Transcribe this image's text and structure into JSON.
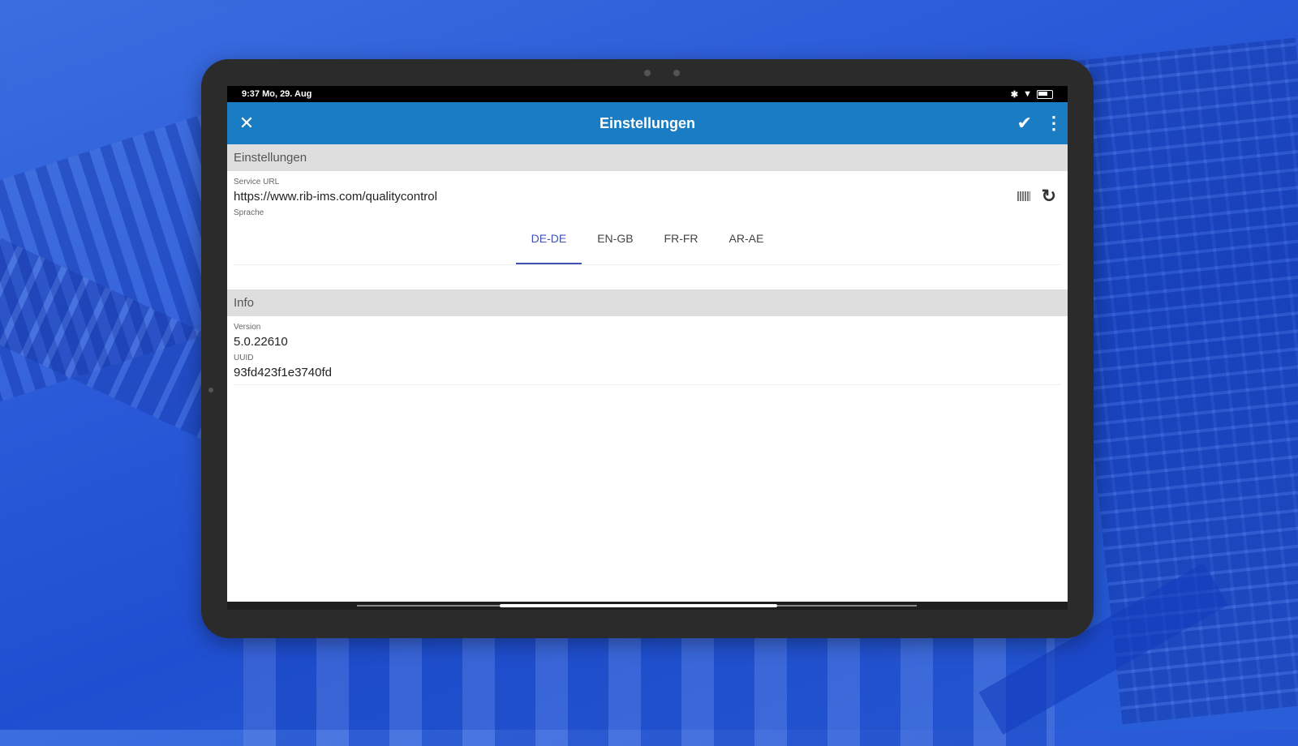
{
  "status_bar": {
    "time_date": "9:37 Mo, 29. Aug",
    "icons": [
      "bluetooth-icon",
      "wifi-icon",
      "battery-icon"
    ]
  },
  "app_bar": {
    "title": "Einstellungen",
    "close_icon": "close-icon",
    "confirm_icon": "check-icon",
    "more_icon": "more-vert-icon"
  },
  "settings": {
    "section_title": "Einstellungen",
    "service_url_label": "Service URL",
    "service_url_value": "https://www.rib-ims.com/qualitycontrol",
    "language_label": "Sprache",
    "languages": [
      {
        "label": "DE-DE",
        "active": true
      },
      {
        "label": "EN-GB",
        "active": false
      },
      {
        "label": "FR-FR",
        "active": false
      },
      {
        "label": "AR-AE",
        "active": false
      }
    ]
  },
  "info": {
    "section_title": "Info",
    "version_label": "Version",
    "version_value": "5.0.22610",
    "uuid_label": "UUID",
    "uuid_value": "93fd423f1e3740fd"
  },
  "colors": {
    "app_bar": "#1a7cc3",
    "tab_active": "#3f51b5",
    "section_bg": "#dedede"
  }
}
